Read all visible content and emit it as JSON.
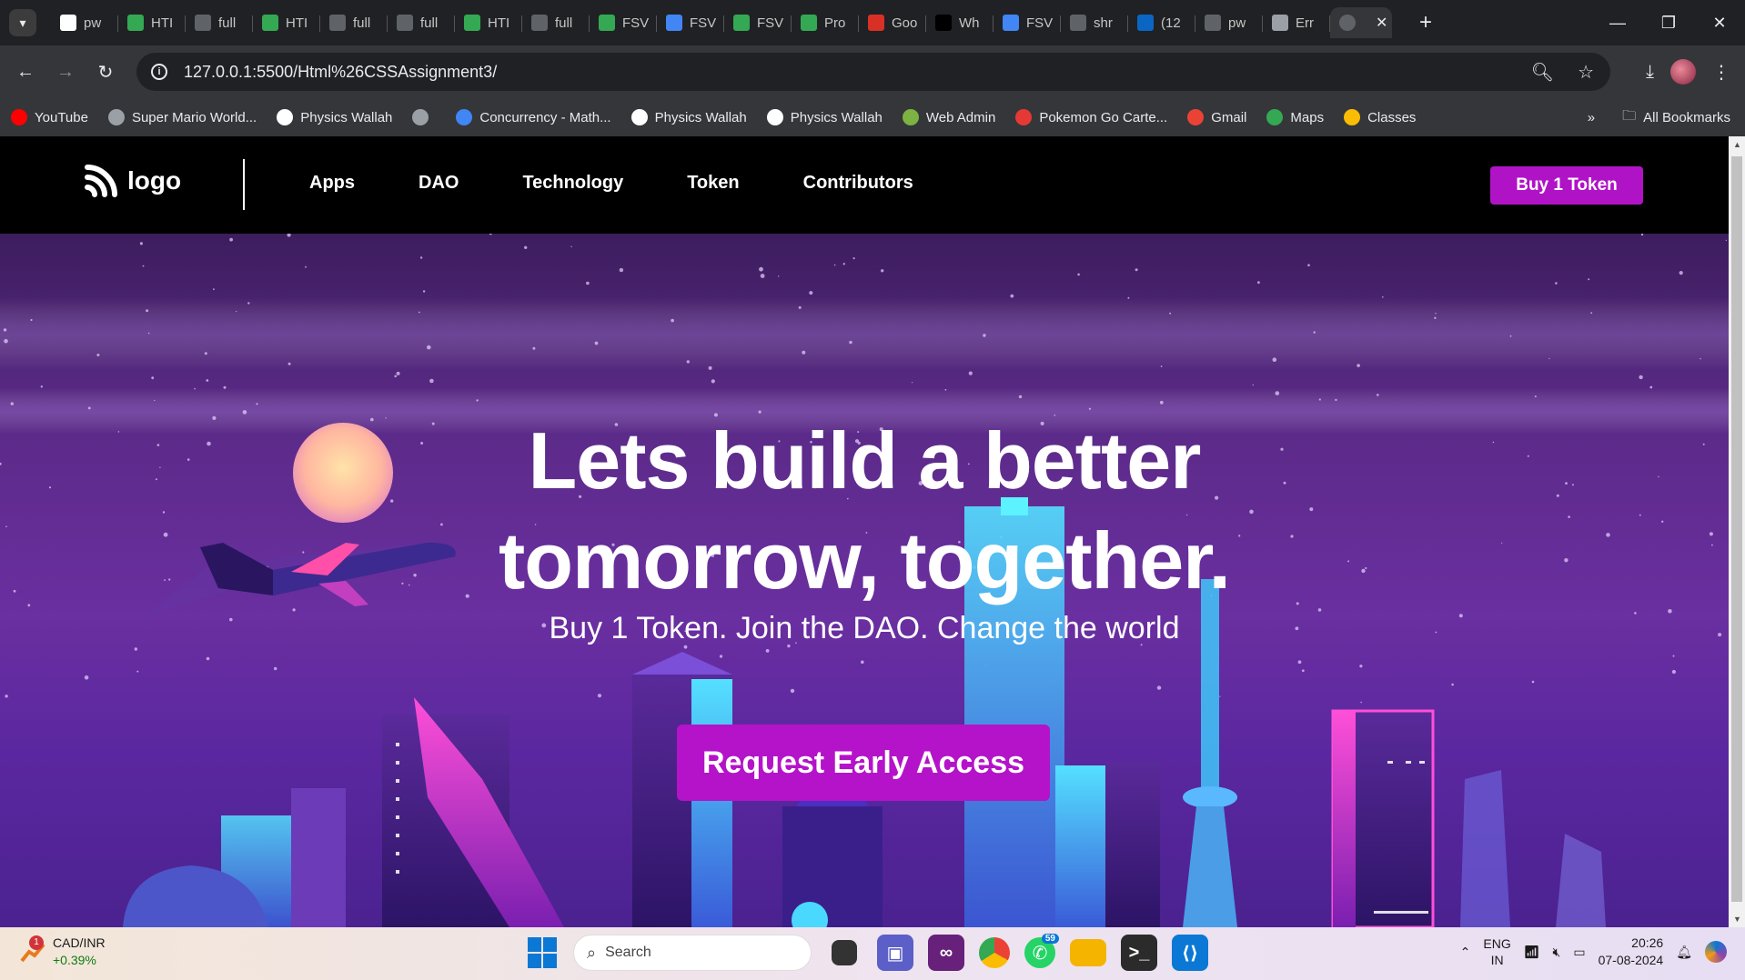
{
  "browser": {
    "tabs": [
      {
        "label": "pw",
        "icon": "wordpress-icon",
        "color": "#ffffff"
      },
      {
        "label": "HTI",
        "icon": "google-drive-icon",
        "color": "#34a853"
      },
      {
        "label": "full",
        "icon": "github-icon",
        "color": "#5f6368"
      },
      {
        "label": "HTI",
        "icon": "google-drive-icon",
        "color": "#34a853"
      },
      {
        "label": "full",
        "icon": "github-icon",
        "color": "#5f6368"
      },
      {
        "label": "full",
        "icon": "github-icon",
        "color": "#5f6368"
      },
      {
        "label": "HTI",
        "icon": "google-drive-icon",
        "color": "#34a853"
      },
      {
        "label": "full",
        "icon": "github-icon",
        "color": "#5f6368"
      },
      {
        "label": "FSV",
        "icon": "google-drive-icon",
        "color": "#34a853"
      },
      {
        "label": "FSV",
        "icon": "google-docs-icon",
        "color": "#4285f4"
      },
      {
        "label": "FSV",
        "icon": "google-drive-icon",
        "color": "#34a853"
      },
      {
        "label": "Pro",
        "icon": "google-drive-icon",
        "color": "#34a853"
      },
      {
        "label": "Goo",
        "icon": "google-slides-icon",
        "color": "#d93025"
      },
      {
        "label": "Wh",
        "icon": "medium-icon",
        "color": "#000000"
      },
      {
        "label": "FSV",
        "icon": "google-docs-icon",
        "color": "#4285f4"
      },
      {
        "label": "shr",
        "icon": "github-icon",
        "color": "#5f6368"
      },
      {
        "label": "(12",
        "icon": "linkedin-icon",
        "color": "#0a66c2"
      },
      {
        "label": "pw",
        "icon": "github-icon",
        "color": "#5f6368"
      },
      {
        "label": "Err",
        "icon": "globe-icon",
        "color": "#9aa0a6"
      }
    ],
    "active_tab_icon": "globe-icon",
    "url": "127.0.0.1:5500/Html%26CSSAssignment3/",
    "bookmarks": [
      {
        "label": "YouTube",
        "icon": "youtube-icon",
        "color": "#ff0000"
      },
      {
        "label": "Super Mario World...",
        "icon": "globe-icon",
        "color": "#9aa0a6"
      },
      {
        "label": "Physics Wallah",
        "icon": "physics-wallah-icon",
        "color": "#ffffff"
      },
      {
        "label": "",
        "icon": "globe-icon",
        "color": "#9aa0a6"
      },
      {
        "label": "Concurrency - Math...",
        "icon": "google-icon",
        "color": "#4285f4"
      },
      {
        "label": "Physics Wallah",
        "icon": "physics-wallah-icon",
        "color": "#ffffff"
      },
      {
        "label": "Physics Wallah",
        "icon": "physics-wallah-icon",
        "color": "#ffffff"
      },
      {
        "label": "Web Admin",
        "icon": "lte-icon",
        "color": "#7cb342"
      },
      {
        "label": "Pokemon Go Carte...",
        "icon": "pokemon-icon",
        "color": "#e53935"
      },
      {
        "label": "Gmail",
        "icon": "gmail-icon",
        "color": "#ea4335"
      },
      {
        "label": "Maps",
        "icon": "maps-icon",
        "color": "#34a853"
      },
      {
        "label": "Classes",
        "icon": "classroom-icon",
        "color": "#fbbc04"
      }
    ],
    "all_bookmarks_label": "All Bookmarks"
  },
  "site": {
    "logo_text": "logo",
    "nav": [
      "Apps",
      "DAO",
      "Technology",
      "Token",
      "Contributors"
    ],
    "buy_button": "Buy 1 Token",
    "headline_line1": "Lets build a better",
    "headline_line2": "tomorrow, together.",
    "subheadline": "Buy 1 Token. Join the DAO. Change the world",
    "cta": "Request Early Access",
    "accent_color": "#b013c6"
  },
  "taskbar": {
    "ticker_name": "CAD/INR",
    "ticker_change": "+0.39%",
    "ticker_badge": "1",
    "search_placeholder": "Search",
    "whatsapp_badge": "59",
    "lang_line1": "ENG",
    "lang_line2": "IN",
    "time": "20:26",
    "date": "07-08-2024"
  }
}
